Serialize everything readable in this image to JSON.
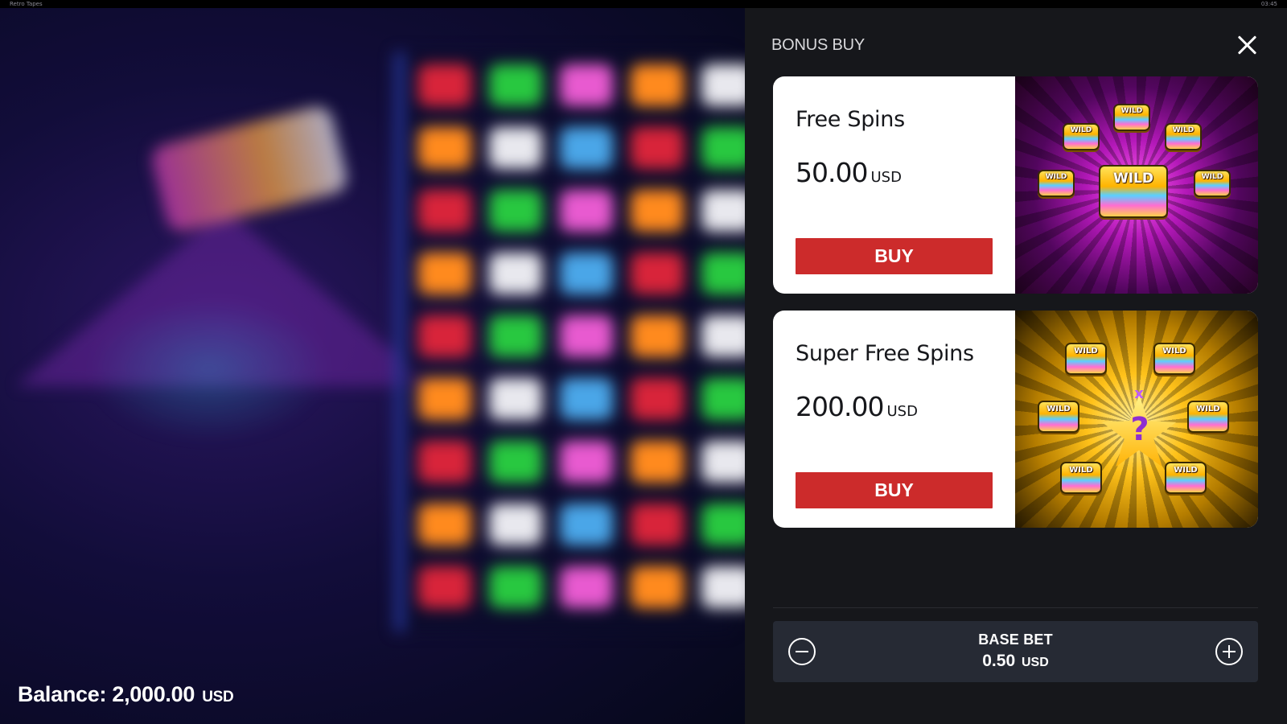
{
  "window": {
    "title": "Retro Tapes",
    "clock": "03:45"
  },
  "game": {
    "balance_label": "Balance:",
    "balance_value": "2,000.00",
    "balance_currency": "USD"
  },
  "panel": {
    "title": "BONUS BUY",
    "options": [
      {
        "name": "Free Spins",
        "price": "50.00",
        "currency": "USD",
        "buy_label": "BUY",
        "art_label": "WILD"
      },
      {
        "name": "Super Free Spins",
        "price": "200.00",
        "currency": "USD",
        "buy_label": "BUY",
        "art_label": "WILD"
      }
    ],
    "bet": {
      "label": "BASE BET",
      "value": "0.50",
      "currency": "USD"
    }
  },
  "colors": {
    "buy_button": "#cc2b2b",
    "panel_bg": "#16171b",
    "bet_box": "#262a34"
  }
}
